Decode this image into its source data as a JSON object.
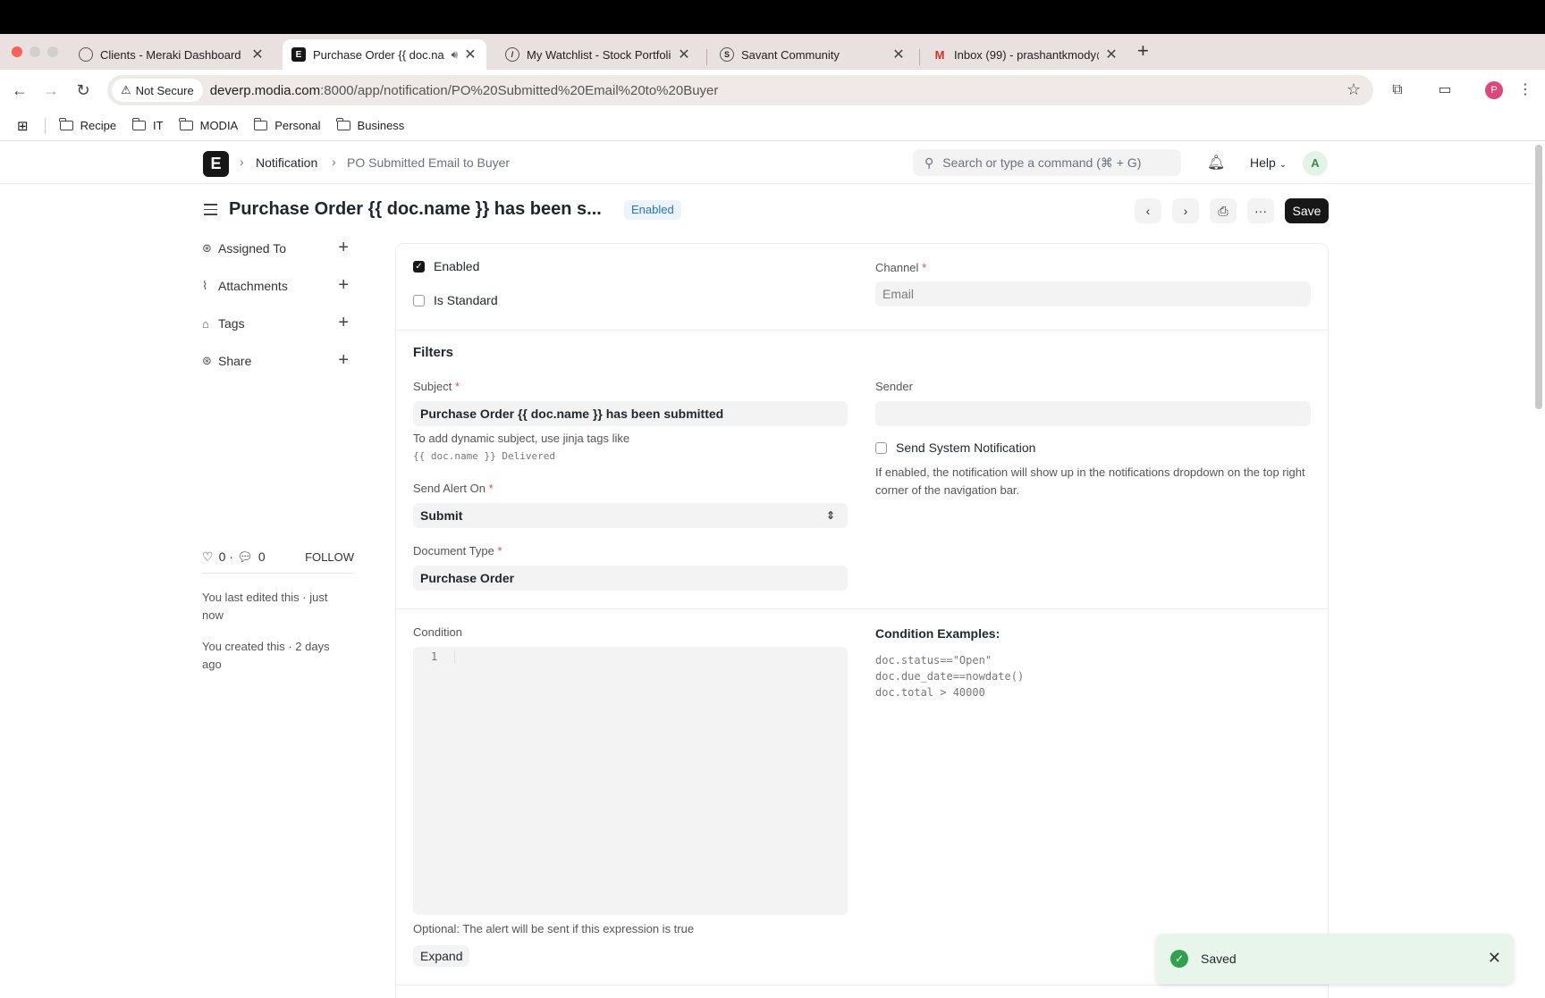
{
  "browser": {
    "tabs": [
      {
        "title": "Clients - Meraki Dashboard",
        "icon": "meraki-icon"
      },
      {
        "title": "Purchase Order {{ doc.na",
        "icon": "erpnext-icon",
        "active": true
      },
      {
        "title": "My Watchlist - Stock Portfolio",
        "icon": "watchlist-icon"
      },
      {
        "title": "Savant Community",
        "icon": "savant-icon"
      },
      {
        "title": "Inbox (99) - prashantkmody@",
        "icon": "gmail-icon"
      }
    ],
    "not_secure": "Not Secure",
    "url_host": "deverp.modia.com",
    "url_path": ":8000/app/notification/PO%20Submitted%20Email%20to%20Buyer",
    "profile_initial": "P",
    "bookmarks": [
      "Recipe",
      "IT",
      "MODIA",
      "Personal",
      "Business"
    ]
  },
  "appbar": {
    "logo": "E",
    "crumb_1": "Notification",
    "crumb_2": "PO Submitted Email to Buyer",
    "search_placeholder": "Search or type a command (⌘ + G)",
    "help": "Help",
    "avatar": "A"
  },
  "header": {
    "title": "Purchase Order {{ doc.name }} has been s...",
    "status": "Enabled",
    "save": "Save"
  },
  "sidebar": {
    "items": [
      "Assigned To",
      "Attachments",
      "Tags",
      "Share"
    ],
    "likes": "0",
    "comments": "0",
    "follow": "FOLLOW",
    "last_edited": "You last edited this · just now",
    "created": "You created this · 2 days ago"
  },
  "form": {
    "enabled_label": "Enabled",
    "is_standard_label": "Is Standard",
    "channel_label": "Channel",
    "channel_value": "Email",
    "filters_title": "Filters",
    "subject_label": "Subject",
    "subject_value": "Purchase Order {{ doc.name }} has been submitted",
    "subject_hint": "To add dynamic subject, use jinja tags like",
    "subject_hint_code": "{{ doc.name }} Delivered",
    "sender_label": "Sender",
    "sys_notif_label": "Send System Notification",
    "sys_notif_hint": "If enabled, the notification will show up in the notifications dropdown on the top right corner of the navigation bar.",
    "send_alert_label": "Send Alert On",
    "send_alert_value": "Submit",
    "doctype_label": "Document Type",
    "doctype_value": "Purchase Order",
    "condition_label": "Condition",
    "line_no": "1",
    "condition_examples_title": "Condition Examples:",
    "condition_examples": "doc.status==\"Open\"\ndoc.due_date==nowdate()\ndoc.total > 40000",
    "condition_hint": "Optional: The alert will be sent if this expression is true",
    "expand": "Expand"
  },
  "toast": {
    "message": "Saved"
  }
}
